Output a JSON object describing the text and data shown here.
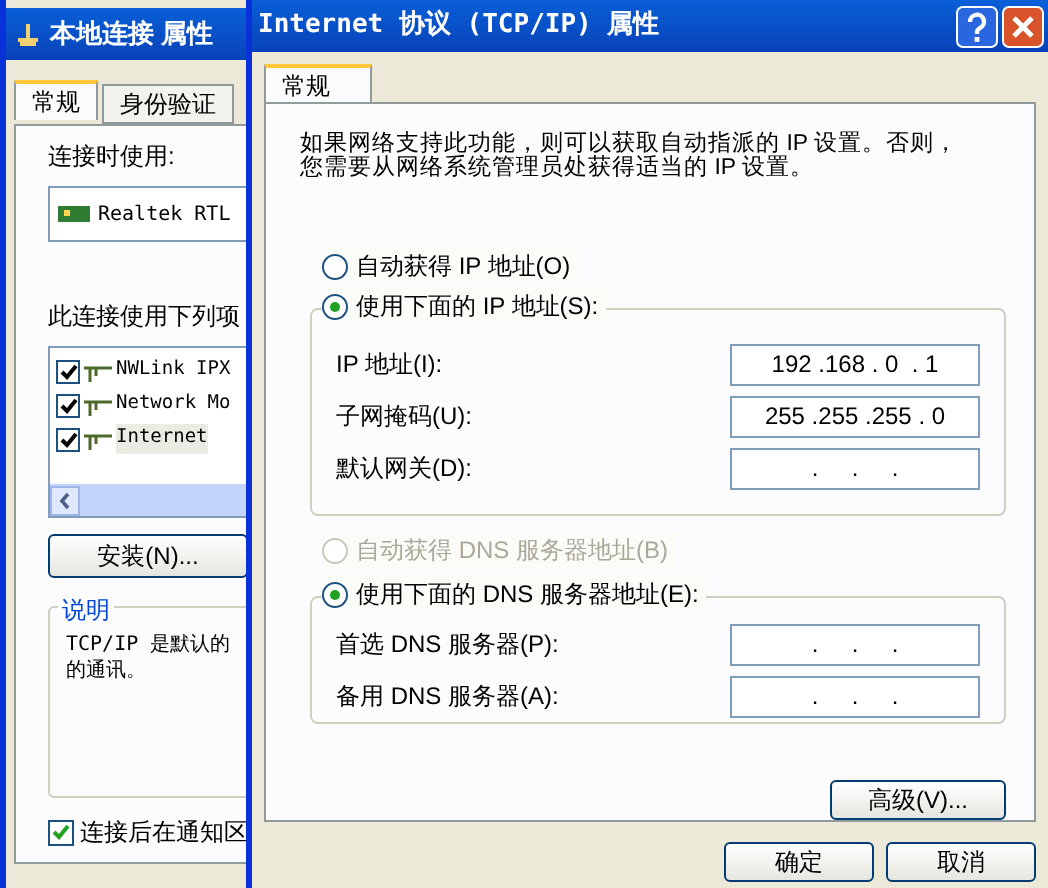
{
  "back_window": {
    "title": "本地连接 属性",
    "tabs": [
      {
        "label": "常规",
        "selected": true
      },
      {
        "label": "身份验证",
        "selected": false
      }
    ],
    "connect_using_label": "连接时使用:",
    "adapter": "Realtek RTL",
    "components_label": "此连接使用下列项",
    "components": [
      {
        "label": "NWLink IPX",
        "checked": true,
        "selected": false
      },
      {
        "label": "Network Mo",
        "checked": true,
        "selected": false
      },
      {
        "label": "Internet",
        "checked": true,
        "selected": true
      }
    ],
    "install_button": "安装(N)...",
    "description_title": "说明",
    "description": [
      "TCP/IP 是默认的",
      "的通讯。"
    ],
    "notify": {
      "label": "连接后在通知区",
      "checked": true
    }
  },
  "window": {
    "title": "Internet 协议 (TCP/IP) 属性",
    "tabs": [
      {
        "label": "常规",
        "selected": true
      }
    ],
    "intro": [
      "如果网络支持此功能，则可以获取自动指派的 IP 设置。否则，",
      "您需要从网络系统管理员处获得适当的 IP 设置。"
    ],
    "ip_auto": {
      "label": "自动获得 IP 地址(O)",
      "selected": false,
      "disabled": false
    },
    "ip_manual": {
      "label": "使用下面的 IP 地址(S):",
      "selected": true,
      "disabled": false
    },
    "ip_fields": [
      {
        "label": "IP 地址(I):",
        "value": "192 .168 . 0  . 1"
      },
      {
        "label": "子网掩码(U):",
        "value": "255 .255 .255 . 0"
      },
      {
        "label": "默认网关(D):",
        "value": ".     .     ."
      }
    ],
    "dns_auto": {
      "label": "自动获得 DNS 服务器地址(B)",
      "selected": false,
      "disabled": true
    },
    "dns_manual": {
      "label": "使用下面的 DNS 服务器地址(E):",
      "selected": true,
      "disabled": false
    },
    "dns_fields": [
      {
        "label": "首选 DNS 服务器(P):",
        "value": ".     .     ."
      },
      {
        "label": "备用 DNS 服务器(A):",
        "value": ".     .     ."
      }
    ],
    "advanced_button": "高级(V)...",
    "buttons": [
      "确定",
      "取消"
    ]
  }
}
